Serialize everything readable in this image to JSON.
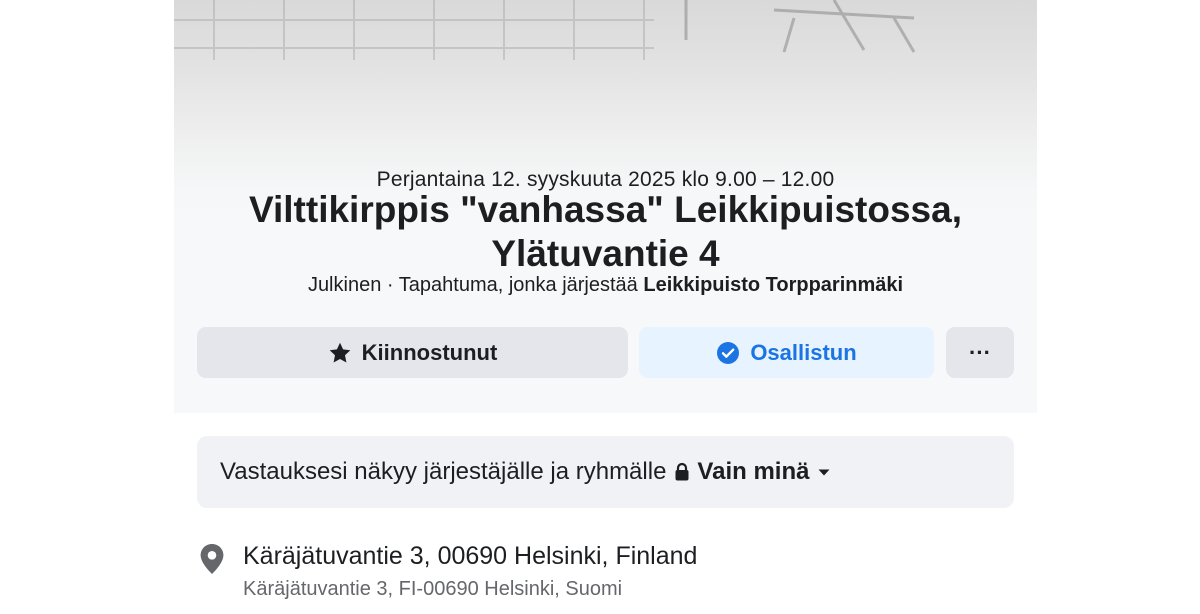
{
  "event": {
    "date_time": "Perjantaina 12. syyskuuta 2025 klo 9.00 – 12.00",
    "title": "Vilttikirppis \"vanhassa\" Leikkipuistossa, Ylätuvantie 4",
    "visibility": "Julkinen",
    "separator": "·",
    "organizer_prefix": "Tapahtuma, jonka järjestää",
    "organizer": "Leikkipuisto Torpparinmäki"
  },
  "actions": {
    "interested_label": "Kiinnostunut",
    "going_label": "Osallistun",
    "more_label": "···"
  },
  "privacy": {
    "text": "Vastauksesi näkyy järjestäjälle ja ryhmälle",
    "audience": "Vain minä"
  },
  "location": {
    "address": "Käräjätuvantie 3, 00690 Helsinki, Finland",
    "address_local": "Käräjätuvantie 3, FI-00690 Helsinki, Suomi"
  },
  "colors": {
    "primary_text": "#1c1e21",
    "secondary_text": "#65676b",
    "accent": "#1b74e4",
    "button_gray": "#e4e6eb",
    "button_blue_bg": "#e7f3ff",
    "box_bg": "#f0f2f5"
  },
  "icons": {
    "interested": "star-icon",
    "going": "check-circle-icon",
    "privacy": "lock-icon",
    "dropdown": "caret-down-icon",
    "location": "map-pin-icon"
  }
}
